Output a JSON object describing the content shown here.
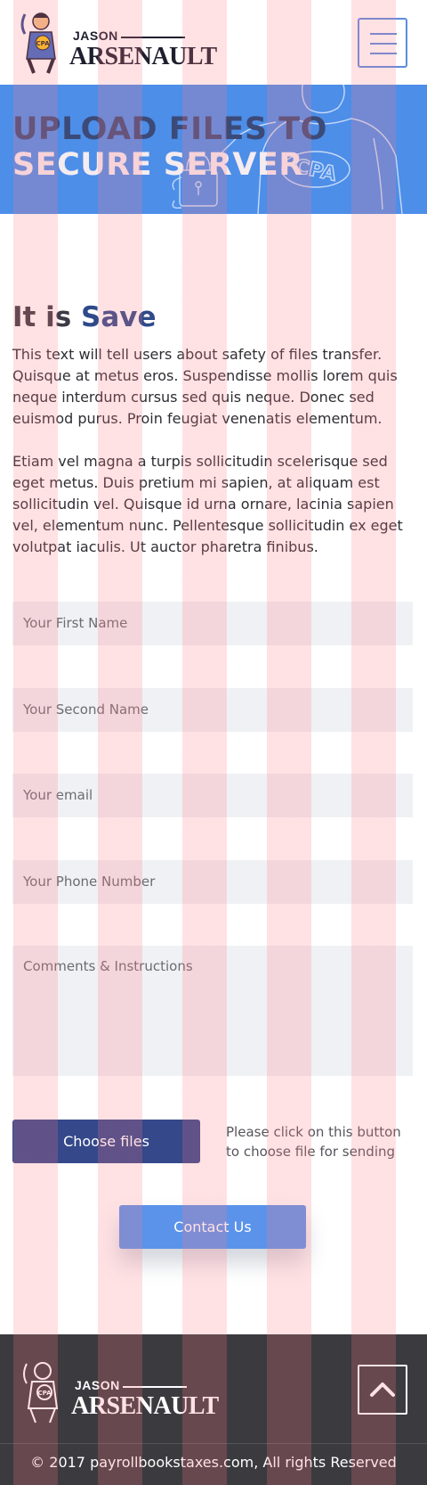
{
  "header": {
    "logo_small": "JASON",
    "logo_big": "ARSENAULT",
    "logo_badge": "CPA",
    "menu_icon": "hamburger-menu-icon"
  },
  "hero": {
    "title_line1": "UPLOAD FILES TO",
    "title_line2": "SECURE SERVER",
    "art_badge": "CPA",
    "background_color": "#4d8ee8"
  },
  "main": {
    "title_prefix": "It is",
    "title_accent": "Save",
    "paragraph1": "This text will tell users about safety of files transfer. Quisque at metus eros. Suspendisse mollis lorem quis neque interdum cursus sed quis neque. Donec sed euismod purus. Proin feugiat venenatis elementum.",
    "paragraph2": "Etiam vel magna a turpis sollicitudin scelerisque sed eget metus. Duis pretium mi sapien, at aliquam est sollicitudin vel. Quisque id urna ornare, lacinia sapien vel, elementum nunc. Pellentesque sollicitudin ex eget volutpat iaculis. Ut auctor pharetra finibus."
  },
  "form": {
    "first_name_placeholder": "Your First Name",
    "second_name_placeholder": "Your Second Name",
    "email_placeholder": "Your email",
    "phone_placeholder": "Your Phone Number",
    "comments_placeholder": "Comments & Instructions",
    "choose_files_label": "Choose files",
    "choose_files_hint": "Please click on this button to choose file for sending",
    "contact_label": "Contact Us"
  },
  "footer": {
    "logo_small": "JASON",
    "logo_big": "ARSENAULT",
    "logo_badge": "CPA",
    "top_icon": "chevron-up-icon",
    "copyright": "© 2017 payrollbookstaxes.com, All rights Reserved"
  },
  "colors": {
    "accent_blue": "#5b93ea",
    "dark_blue": "#34488a",
    "footer_bg": "#3b3b3f"
  }
}
